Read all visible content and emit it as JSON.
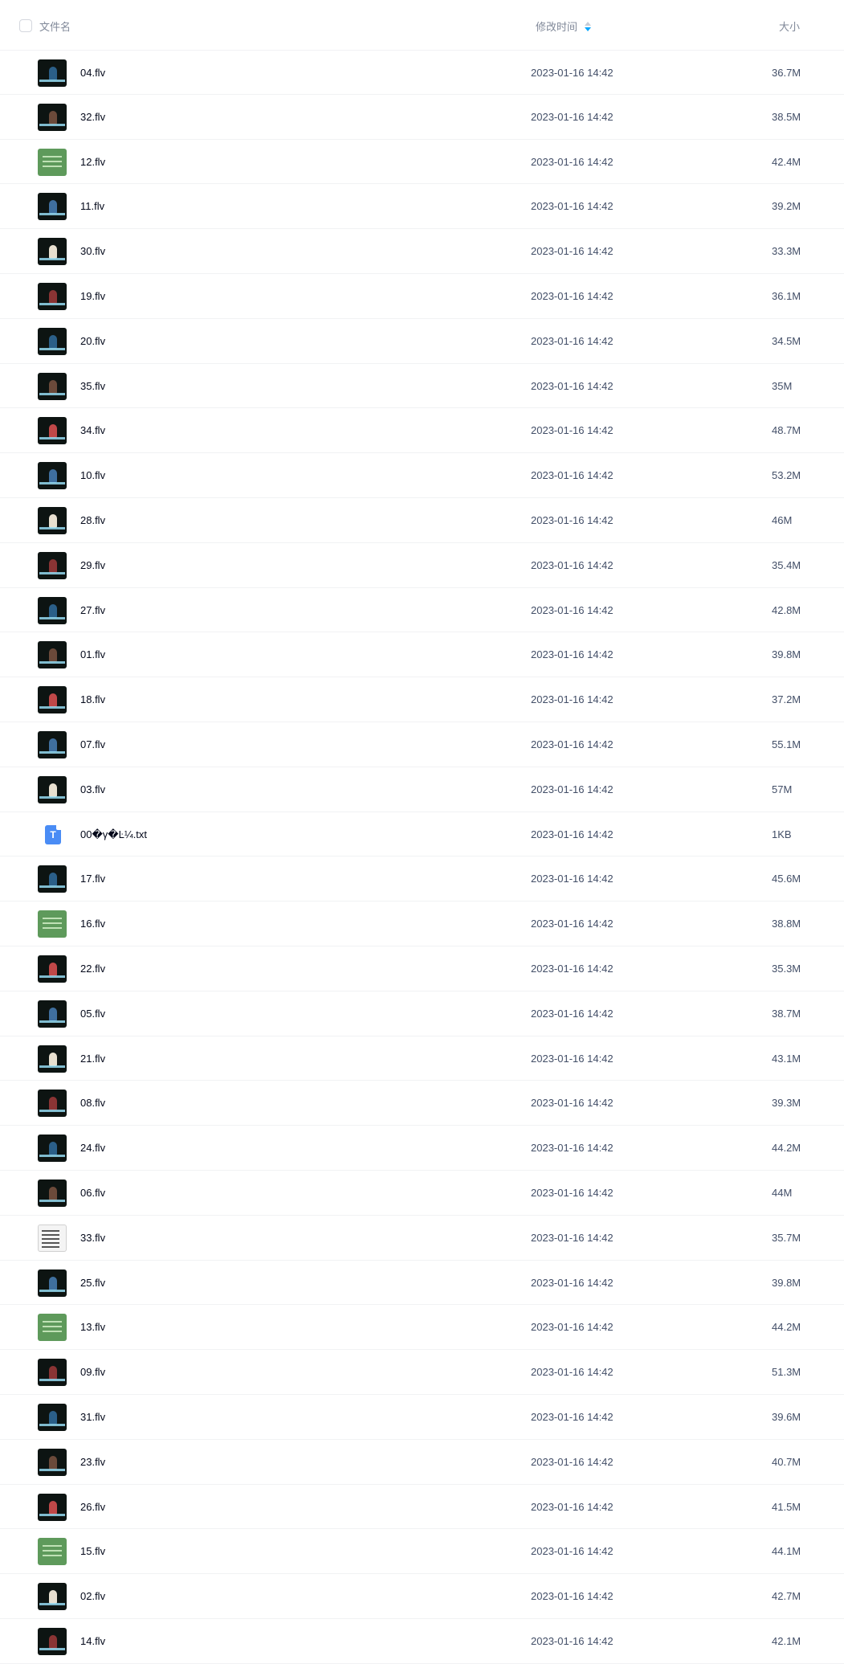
{
  "header": {
    "name_label": "文件名",
    "time_label": "修改时间",
    "size_label": "大小",
    "sort_icon": "sort-desc-icon",
    "sort_active_color": "#06a7ff"
  },
  "files": [
    {
      "name": "04.flv",
      "modified": "2023-01-16 14:42",
      "size": "36.7M",
      "icon": "video-thumbnail"
    },
    {
      "name": "32.flv",
      "modified": "2023-01-16 14:42",
      "size": "38.5M",
      "icon": "video-thumbnail"
    },
    {
      "name": "12.flv",
      "modified": "2023-01-16 14:42",
      "size": "42.4M",
      "icon": "video-thumbnail"
    },
    {
      "name": "11.flv",
      "modified": "2023-01-16 14:42",
      "size": "39.2M",
      "icon": "video-thumbnail"
    },
    {
      "name": "30.flv",
      "modified": "2023-01-16 14:42",
      "size": "33.3M",
      "icon": "video-thumbnail"
    },
    {
      "name": "19.flv",
      "modified": "2023-01-16 14:42",
      "size": "36.1M",
      "icon": "video-thumbnail"
    },
    {
      "name": "20.flv",
      "modified": "2023-01-16 14:42",
      "size": "34.5M",
      "icon": "video-thumbnail"
    },
    {
      "name": "35.flv",
      "modified": "2023-01-16 14:42",
      "size": "35M",
      "icon": "video-thumbnail"
    },
    {
      "name": "34.flv",
      "modified": "2023-01-16 14:42",
      "size": "48.7M",
      "icon": "video-thumbnail"
    },
    {
      "name": "10.flv",
      "modified": "2023-01-16 14:42",
      "size": "53.2M",
      "icon": "video-thumbnail"
    },
    {
      "name": "28.flv",
      "modified": "2023-01-16 14:42",
      "size": "46M",
      "icon": "video-thumbnail"
    },
    {
      "name": "29.flv",
      "modified": "2023-01-16 14:42",
      "size": "35.4M",
      "icon": "video-thumbnail"
    },
    {
      "name": "27.flv",
      "modified": "2023-01-16 14:42",
      "size": "42.8M",
      "icon": "video-thumbnail"
    },
    {
      "name": "01.flv",
      "modified": "2023-01-16 14:42",
      "size": "39.8M",
      "icon": "video-thumbnail"
    },
    {
      "name": "18.flv",
      "modified": "2023-01-16 14:42",
      "size": "37.2M",
      "icon": "video-thumbnail"
    },
    {
      "name": "07.flv",
      "modified": "2023-01-16 14:42",
      "size": "55.1M",
      "icon": "video-thumbnail"
    },
    {
      "name": "03.flv",
      "modified": "2023-01-16 14:42",
      "size": "57M",
      "icon": "video-thumbnail"
    },
    {
      "name": "00�γ�Ŀ¼.txt",
      "modified": "2023-01-16 14:42",
      "size": "1KB",
      "icon": "txt-file-icon",
      "icon_glyph": "T"
    },
    {
      "name": "17.flv",
      "modified": "2023-01-16 14:42",
      "size": "45.6M",
      "icon": "video-thumbnail"
    },
    {
      "name": "16.flv",
      "modified": "2023-01-16 14:42",
      "size": "38.8M",
      "icon": "video-thumbnail"
    },
    {
      "name": "22.flv",
      "modified": "2023-01-16 14:42",
      "size": "35.3M",
      "icon": "video-thumbnail"
    },
    {
      "name": "05.flv",
      "modified": "2023-01-16 14:42",
      "size": "38.7M",
      "icon": "video-thumbnail"
    },
    {
      "name": "21.flv",
      "modified": "2023-01-16 14:42",
      "size": "43.1M",
      "icon": "video-thumbnail"
    },
    {
      "name": "08.flv",
      "modified": "2023-01-16 14:42",
      "size": "39.3M",
      "icon": "video-thumbnail"
    },
    {
      "name": "24.flv",
      "modified": "2023-01-16 14:42",
      "size": "44.2M",
      "icon": "video-thumbnail"
    },
    {
      "name": "06.flv",
      "modified": "2023-01-16 14:42",
      "size": "44M",
      "icon": "video-thumbnail"
    },
    {
      "name": "33.flv",
      "modified": "2023-01-16 14:42",
      "size": "35.7M",
      "icon": "video-thumbnail"
    },
    {
      "name": "25.flv",
      "modified": "2023-01-16 14:42",
      "size": "39.8M",
      "icon": "video-thumbnail"
    },
    {
      "name": "13.flv",
      "modified": "2023-01-16 14:42",
      "size": "44.2M",
      "icon": "video-thumbnail"
    },
    {
      "name": "09.flv",
      "modified": "2023-01-16 14:42",
      "size": "51.3M",
      "icon": "video-thumbnail"
    },
    {
      "name": "31.flv",
      "modified": "2023-01-16 14:42",
      "size": "39.6M",
      "icon": "video-thumbnail"
    },
    {
      "name": "23.flv",
      "modified": "2023-01-16 14:42",
      "size": "40.7M",
      "icon": "video-thumbnail"
    },
    {
      "name": "26.flv",
      "modified": "2023-01-16 14:42",
      "size": "41.5M",
      "icon": "video-thumbnail"
    },
    {
      "name": "15.flv",
      "modified": "2023-01-16 14:42",
      "size": "44.1M",
      "icon": "video-thumbnail"
    },
    {
      "name": "02.flv",
      "modified": "2023-01-16 14:42",
      "size": "42.7M",
      "icon": "video-thumbnail"
    },
    {
      "name": "14.flv",
      "modified": "2023-01-16 14:42",
      "size": "42.1M",
      "icon": "video-thumbnail"
    }
  ]
}
